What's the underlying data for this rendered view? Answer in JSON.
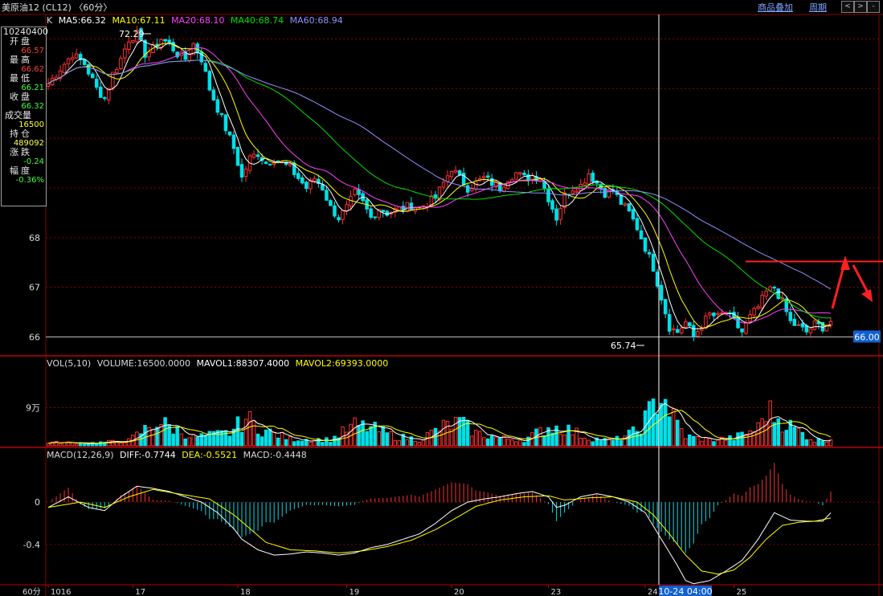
{
  "window": {
    "title": "美原油12 (CL12) 〈60分〉",
    "links": [
      "商品叠加",
      "周期"
    ],
    "nav_buttons": [
      "<",
      ">",
      "+",
      "-"
    ]
  },
  "info_panel": {
    "date": "10240400",
    "rows": [
      {
        "label": "开盘",
        "value": "66.57",
        "color": "#ff4040"
      },
      {
        "label": "最高",
        "value": "66.62",
        "color": "#ff4040"
      },
      {
        "label": "最低",
        "value": "66.21",
        "color": "#40ff40"
      },
      {
        "label": "收盘",
        "value": "66.32",
        "color": "#40ff40"
      },
      {
        "label": "成交量",
        "value": "16500",
        "color": "#ffff40"
      },
      {
        "label": "持仓",
        "value": "489092",
        "color": "#ffff40"
      },
      {
        "label": "涨跌",
        "value": "-0.24",
        "color": "#40ff40"
      },
      {
        "label": "幅度",
        "value": "-0.36%",
        "color": "#40ff40"
      }
    ]
  },
  "legends": {
    "price": [
      {
        "text": "K",
        "color": "#d8d8d8"
      },
      {
        "text": "MA5:66.32",
        "color": "#ffffff"
      },
      {
        "text": "MA10:67.11",
        "color": "#ffff00"
      },
      {
        "text": "MA20:68.10",
        "color": "#ff40ff"
      },
      {
        "text": "MA40:68.74",
        "color": "#00e000"
      },
      {
        "text": "MA60:68.94",
        "color": "#9090ff"
      }
    ],
    "volume": [
      {
        "text": "VOL(5,10)",
        "color": "#d8d8d8"
      },
      {
        "text": "VOLUME:16500.0000",
        "color": "#d8d8d8"
      },
      {
        "text": "MAVOL1:88307.4000",
        "color": "#ffffff"
      },
      {
        "text": "MAVOL2:69393.0000",
        "color": "#ffff00"
      }
    ],
    "macd": [
      {
        "text": "MACD(12,26,9)",
        "color": "#d8d8d8"
      },
      {
        "text": "DIFF:-0.7744",
        "color": "#ffffff"
      },
      {
        "text": "DEA:-0.5521",
        "color": "#ffff00"
      },
      {
        "text": "MACD:-0.4448",
        "color": "#d8d8d8"
      }
    ]
  },
  "price_marks": {
    "high_label": "72.29",
    "low_label": "65.74",
    "current_price": "66.00"
  },
  "crosshair_label": "10-24 04:00",
  "period_label": "60分",
  "colors": {
    "up": "#ff3030",
    "down": "#00e0e8",
    "grid": "#8b0000",
    "axis": "#8b0000",
    "arrow": "#ff2020"
  },
  "chart_data": [
    {
      "type": "candlestick",
      "title": "美原油12 (CL12) 〈60分〉",
      "ylim": [
        65.7,
        72.3
      ],
      "y_ticks": [
        66,
        67,
        68
      ],
      "y_tick_labels": [
        "66",
        "67",
        "68"
      ],
      "x_tick_labels": [
        "1016",
        "17",
        "18",
        "19",
        "20",
        "23",
        "24",
        "25"
      ],
      "x_tick_index": [
        0,
        21,
        47,
        74,
        100,
        124,
        148,
        170
      ],
      "num_bars": 195,
      "close_anchors": [
        [
          0,
          71.1
        ],
        [
          3,
          71.4
        ],
        [
          6,
          71.7
        ],
        [
          9,
          71.5
        ],
        [
          12,
          71.0
        ],
        [
          14,
          70.8
        ],
        [
          16,
          71.3
        ],
        [
          18,
          71.6
        ],
        [
          20,
          72.0
        ],
        [
          22,
          72.1
        ],
        [
          24,
          71.7
        ],
        [
          26,
          71.8
        ],
        [
          28,
          72.0
        ],
        [
          30,
          71.9
        ],
        [
          32,
          71.7
        ],
        [
          34,
          71.6
        ],
        [
          36,
          71.9
        ],
        [
          38,
          71.6
        ],
        [
          40,
          71.0
        ],
        [
          42,
          70.6
        ],
        [
          44,
          70.2
        ],
        [
          46,
          69.8
        ],
        [
          48,
          69.2
        ],
        [
          50,
          69.6
        ],
        [
          52,
          69.7
        ],
        [
          54,
          69.5
        ],
        [
          56,
          69.6
        ],
        [
          58,
          69.5
        ],
        [
          60,
          69.4
        ],
        [
          62,
          69.2
        ],
        [
          64,
          69.0
        ],
        [
          66,
          69.2
        ],
        [
          68,
          69.0
        ],
        [
          70,
          68.6
        ],
        [
          72,
          68.4
        ],
        [
          74,
          68.6
        ],
        [
          76,
          68.9
        ],
        [
          78,
          68.7
        ],
        [
          80,
          68.4
        ],
        [
          82,
          68.6
        ],
        [
          84,
          68.5
        ],
        [
          86,
          68.55
        ],
        [
          88,
          68.6
        ],
        [
          90,
          68.65
        ],
        [
          92,
          68.6
        ],
        [
          94,
          68.7
        ],
        [
          96,
          68.8
        ],
        [
          98,
          69.1
        ],
        [
          100,
          69.4
        ],
        [
          102,
          69.2
        ],
        [
          104,
          69.0
        ],
        [
          106,
          69.1
        ],
        [
          108,
          69.2
        ],
        [
          110,
          69.1
        ],
        [
          112,
          69.0
        ],
        [
          114,
          69.2
        ],
        [
          116,
          69.3
        ],
        [
          118,
          69.2
        ],
        [
          120,
          69.25
        ],
        [
          122,
          69.2
        ],
        [
          124,
          68.8
        ],
        [
          126,
          68.4
        ],
        [
          128,
          68.85
        ],
        [
          130,
          69.0
        ],
        [
          132,
          69.05
        ],
        [
          134,
          69.3
        ],
        [
          136,
          69.1
        ],
        [
          138,
          68.9
        ],
        [
          140,
          68.95
        ],
        [
          142,
          68.7
        ],
        [
          144,
          68.5
        ],
        [
          146,
          68.2
        ],
        [
          148,
          67.8
        ],
        [
          150,
          67.4
        ],
        [
          152,
          66.8
        ],
        [
          154,
          66.2
        ],
        [
          156,
          66.1
        ],
        [
          158,
          66.3
        ],
        [
          160,
          66.0
        ],
        [
          162,
          66.25
        ],
        [
          164,
          66.45
        ],
        [
          166,
          66.4
        ],
        [
          168,
          66.5
        ],
        [
          170,
          66.3
        ],
        [
          172,
          66.1
        ],
        [
          174,
          66.4
        ],
        [
          176,
          66.6
        ],
        [
          178,
          66.9
        ],
        [
          180,
          67.0
        ],
        [
          182,
          66.7
        ],
        [
          184,
          66.3
        ],
        [
          186,
          66.2
        ],
        [
          188,
          66.1
        ],
        [
          190,
          66.25
        ],
        [
          192,
          66.2
        ],
        [
          194,
          66.32
        ]
      ],
      "ma_periods": [
        5,
        10,
        20,
        40,
        60
      ],
      "annotations": [
        "72.29",
        "65.74",
        "66.00"
      ]
    },
    {
      "type": "bar",
      "title": "VOL(5,10)",
      "y_tick_labels": [
        "9万"
      ],
      "y_ticks": [
        90000
      ],
      "ylim": [
        0,
        180000
      ],
      "volume_anchors": [
        [
          0,
          8000
        ],
        [
          10,
          6000
        ],
        [
          20,
          12000
        ],
        [
          27,
          58000
        ],
        [
          36,
          20000
        ],
        [
          45,
          30000
        ],
        [
          49,
          65000
        ],
        [
          53,
          38000
        ],
        [
          60,
          16000
        ],
        [
          70,
          14000
        ],
        [
          76,
          48000
        ],
        [
          80,
          42000
        ],
        [
          86,
          22000
        ],
        [
          92,
          15000
        ],
        [
          98,
          45000
        ],
        [
          102,
          55000
        ],
        [
          106,
          30000
        ],
        [
          112,
          18000
        ],
        [
          118,
          14000
        ],
        [
          124,
          44000
        ],
        [
          128,
          42000
        ],
        [
          134,
          18000
        ],
        [
          140,
          12000
        ],
        [
          146,
          35000
        ],
        [
          150,
          90000
        ],
        [
          152,
          130000
        ],
        [
          155,
          65000
        ],
        [
          158,
          22000
        ],
        [
          164,
          14000
        ],
        [
          170,
          18000
        ],
        [
          176,
          42000
        ],
        [
          178,
          85000
        ],
        [
          182,
          58000
        ],
        [
          186,
          35000
        ],
        [
          190,
          12000
        ],
        [
          194,
          16500
        ]
      ],
      "series": [
        {
          "name": "MAVOL1"
        },
        {
          "name": "MAVOL2"
        }
      ]
    },
    {
      "type": "bar",
      "title": "MACD(12,26,9)",
      "y_tick_labels": [
        "0",
        "-0.4"
      ],
      "y_ticks": [
        0,
        -0.4
      ],
      "ylim": [
        -0.78,
        0.38
      ],
      "diff_anchors": [
        [
          0,
          -0.05
        ],
        [
          5,
          0.05
        ],
        [
          10,
          -0.05
        ],
        [
          14,
          -0.08
        ],
        [
          18,
          0.05
        ],
        [
          22,
          0.15
        ],
        [
          26,
          0.13
        ],
        [
          30,
          0.1
        ],
        [
          34,
          0.05
        ],
        [
          38,
          0.0
        ],
        [
          42,
          -0.1
        ],
        [
          46,
          -0.25
        ],
        [
          48,
          -0.35
        ],
        [
          52,
          -0.45
        ],
        [
          56,
          -0.5
        ],
        [
          60,
          -0.49
        ],
        [
          64,
          -0.47
        ],
        [
          68,
          -0.48
        ],
        [
          72,
          -0.5
        ],
        [
          76,
          -0.48
        ],
        [
          80,
          -0.43
        ],
        [
          84,
          -0.4
        ],
        [
          88,
          -0.35
        ],
        [
          92,
          -0.3
        ],
        [
          96,
          -0.2
        ],
        [
          100,
          -0.08
        ],
        [
          104,
          0.0
        ],
        [
          108,
          0.03
        ],
        [
          112,
          0.05
        ],
        [
          116,
          0.08
        ],
        [
          120,
          0.1
        ],
        [
          124,
          0.05
        ],
        [
          126,
          -0.05
        ],
        [
          128,
          -0.03
        ],
        [
          132,
          0.05
        ],
        [
          136,
          0.08
        ],
        [
          140,
          0.05
        ],
        [
          144,
          0.0
        ],
        [
          148,
          -0.1
        ],
        [
          152,
          -0.35
        ],
        [
          156,
          -0.6
        ],
        [
          158,
          -0.74
        ],
        [
          160,
          -0.77
        ],
        [
          164,
          -0.74
        ],
        [
          168,
          -0.65
        ],
        [
          172,
          -0.55
        ],
        [
          176,
          -0.35
        ],
        [
          180,
          -0.1
        ],
        [
          184,
          -0.17
        ],
        [
          188,
          -0.18
        ],
        [
          192,
          -0.18
        ],
        [
          194,
          -0.1
        ]
      ],
      "dea_anchors": [
        [
          0,
          -0.05
        ],
        [
          8,
          0.0
        ],
        [
          14,
          -0.05
        ],
        [
          20,
          0.05
        ],
        [
          26,
          0.12
        ],
        [
          32,
          0.08
        ],
        [
          40,
          0.03
        ],
        [
          46,
          -0.12
        ],
        [
          50,
          -0.25
        ],
        [
          54,
          -0.38
        ],
        [
          60,
          -0.45
        ],
        [
          66,
          -0.46
        ],
        [
          72,
          -0.48
        ],
        [
          78,
          -0.46
        ],
        [
          84,
          -0.42
        ],
        [
          90,
          -0.36
        ],
        [
          96,
          -0.26
        ],
        [
          102,
          -0.13
        ],
        [
          106,
          -0.04
        ],
        [
          112,
          0.02
        ],
        [
          118,
          0.05
        ],
        [
          124,
          0.06
        ],
        [
          128,
          0.02
        ],
        [
          134,
          0.04
        ],
        [
          140,
          0.05
        ],
        [
          146,
          0.0
        ],
        [
          150,
          -0.12
        ],
        [
          154,
          -0.3
        ],
        [
          158,
          -0.5
        ],
        [
          162,
          -0.65
        ],
        [
          166,
          -0.68
        ],
        [
          170,
          -0.64
        ],
        [
          174,
          -0.52
        ],
        [
          178,
          -0.35
        ],
        [
          182,
          -0.22
        ],
        [
          186,
          -0.19
        ],
        [
          190,
          -0.18
        ],
        [
          194,
          -0.15
        ]
      ],
      "series": [
        {
          "name": "DIFF"
        },
        {
          "name": "DEA"
        },
        {
          "name": "MACD"
        }
      ]
    }
  ]
}
